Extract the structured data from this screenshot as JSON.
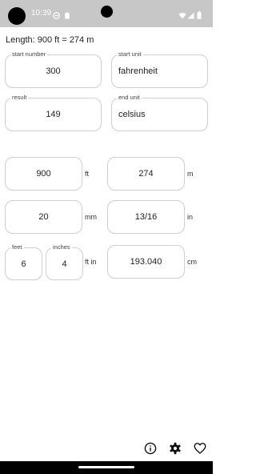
{
  "status_bar": {
    "time": "10:39",
    "icons": [
      "do-not-disturb-icon",
      "clipboard-icon",
      "wifi-icon",
      "signal-icon",
      "battery-icon"
    ]
  },
  "headline": "Length: 900 ft = 274 m",
  "temperature": {
    "start_number": {
      "label": "start number",
      "value": "300"
    },
    "start_unit": {
      "label": "start unit",
      "value": "fahrenheit"
    },
    "result": {
      "label": "result",
      "value": "149"
    },
    "end_unit": {
      "label": "end unit",
      "value": "celsius"
    }
  },
  "length": {
    "feet_value": "900",
    "feet_unit": "ft",
    "meters_value": "274",
    "meters_unit": "m",
    "mm_value": "20",
    "mm_unit": "mm",
    "inch_value": "13/16",
    "inch_unit": "in",
    "feet_label": "feet",
    "feet_field": "6",
    "inches_label": "inches",
    "inches_field": "4",
    "ftin_unit": "ft in",
    "cm_value": "193.040",
    "cm_unit": "cm"
  },
  "bottom_bar": {
    "icons": [
      "info-icon",
      "gear-icon",
      "heart-icon"
    ]
  },
  "colors": {
    "status_bar_bg": "#c7c7c7",
    "field_border": "#cfcfcf",
    "nav_bar": "#000000"
  }
}
